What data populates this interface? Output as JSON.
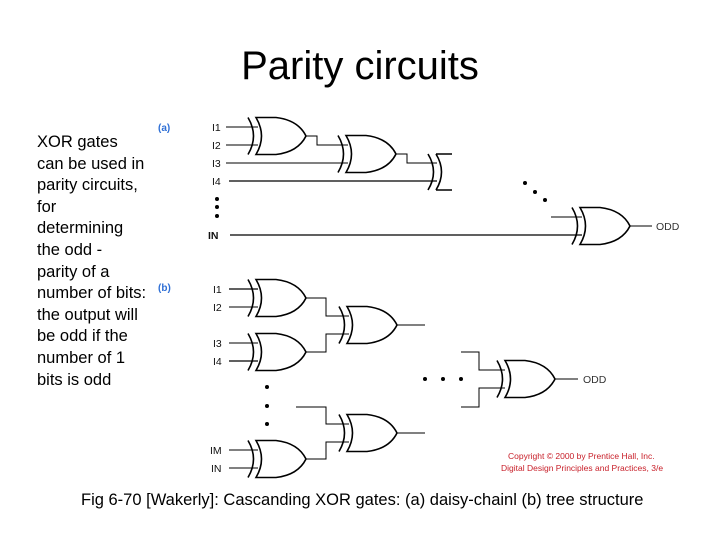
{
  "slide": {
    "title": "Parity circuits",
    "body_text": "XOR gates can be used in parity circuits, for determining the odd - parity of a number of bits: the output will be odd if the number of 1 bits is odd",
    "caption": "Fig 6-70 [Wakerly]: Cascanding XOR gates: (a) daisy-chainl (b) tree structure"
  },
  "figure": {
    "part_a": {
      "label": "(a)",
      "inputs": [
        "I1",
        "I2",
        "I3",
        "I4",
        "IN"
      ],
      "output": "ODD"
    },
    "part_b": {
      "label": "(b)",
      "inputs": [
        "I1",
        "I2",
        "I3",
        "I4",
        "IM",
        "IN"
      ],
      "output": "ODD"
    },
    "copyright": {
      "line1": "Copyright © 2000 by Prentice Hall, Inc.",
      "line2": "Digital Design Principles and Practices, 3/e",
      "color": "#c8202a"
    },
    "label_color": "#2e6fd6"
  }
}
